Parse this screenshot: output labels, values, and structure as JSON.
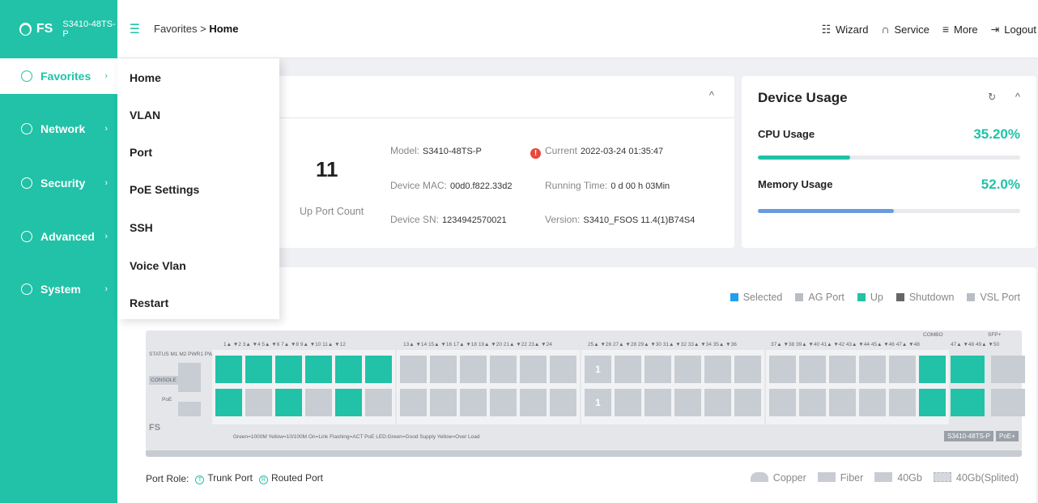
{
  "brand": {
    "logo": "FS",
    "model": "S3410-48TS-P"
  },
  "sidebar": {
    "items": [
      {
        "label": "Favorites",
        "icon": "star-icon"
      },
      {
        "label": "Network",
        "icon": "globe-icon"
      },
      {
        "label": "Security",
        "icon": "shield-icon"
      },
      {
        "label": "Advanced",
        "icon": "advanced-icon"
      },
      {
        "label": "System",
        "icon": "gear-icon"
      }
    ]
  },
  "breadcrumb": {
    "parent": "Favorites",
    "sep": ">",
    "current": "Home"
  },
  "top_actions": [
    {
      "label": "Wizard",
      "icon": "wizard-icon"
    },
    {
      "label": "Service",
      "icon": "headset-icon"
    },
    {
      "label": "More",
      "icon": "list-icon"
    },
    {
      "label": "Logout",
      "icon": "logout-icon"
    }
  ],
  "favorites_menu": [
    "Home",
    "VLAN",
    "Port",
    "PoE Settings",
    "SSH",
    "Voice Vlan",
    "Restart"
  ],
  "device_info": {
    "port_count": "11",
    "port_count_label": "Up Port Count",
    "model_label": "Model:",
    "model": "S3410-48TS-P",
    "mac_label": "Device MAC:",
    "mac": "00d0.f822.33d2",
    "sn_label": "Device SN:",
    "sn": "1234942570021",
    "current_label": "Current",
    "current": "2022-03-24 01:35:47",
    "running_label": "Running Time:",
    "running": "0 d 00 h 03Min",
    "version_label": "Version:",
    "version": "S3410_FSOS 11.4(1)B74S4"
  },
  "device_usage": {
    "title": "Device Usage",
    "cpu_label": "CPU Usage",
    "cpu_value": "35.20%",
    "cpu_fraction": 0.352,
    "mem_label": "Memory Usage",
    "mem_value": "52.0%",
    "mem_fraction": 0.52
  },
  "port_legend": [
    "Selected",
    "AG Port",
    "Up",
    "Shutdown",
    "VSL Port"
  ],
  "panel": {
    "status_labels": "STATUS M1  M2  PWR1 PWR2 PoE",
    "console": "CONSOLE",
    "poe": "PoE",
    "led_legend": "Green=1000M   Yellow=10/100M   On=Link   Flashing=ACT   PoE LED:Green=Good Supply   Yellow=Over Load",
    "model_tag": "S3410-48TS-P",
    "poe_tag": "PoE+",
    "combo_label": "COMBO",
    "sfp_label": "SFP+",
    "group_labels": [
      "1▲ ▼2   3▲ ▼4   5▲ ▼6   7▲ ▼8   9▲ ▼10  11▲ ▼12",
      "13▲ ▼14  15▲ ▼16  17▲ ▼18  19▲ ▼20  21▲ ▼22  23▲ ▼24",
      "25▲ ▼26  27▲ ▼28  29▲ ▼30  31▲ ▼32  33▲ ▼34  35▲ ▼36",
      "37▲ ▼38  39▲ ▼40  41▲ ▼42  43▲ ▼44  45▲ ▼46  47▲ ▼48",
      "47▲ ▼48  49▲ ▼50"
    ],
    "lag_number": "1",
    "up_top": [
      1,
      2,
      3,
      4,
      5,
      6,
      24
    ],
    "up_bottom": [
      1,
      3,
      5,
      24
    ]
  },
  "port_role": {
    "label": "Port Role:",
    "trunk": "Trunk Port",
    "trunk_icon": "T",
    "routed": "Routed Port",
    "routed_icon": "R"
  },
  "port_types": [
    "Copper",
    "Fiber",
    "40Gb",
    "40Gb(Splited)"
  ],
  "colors": {
    "accent": "#21c2a7",
    "memory_bar": "#6a9be0",
    "alert": "#e9473a"
  }
}
